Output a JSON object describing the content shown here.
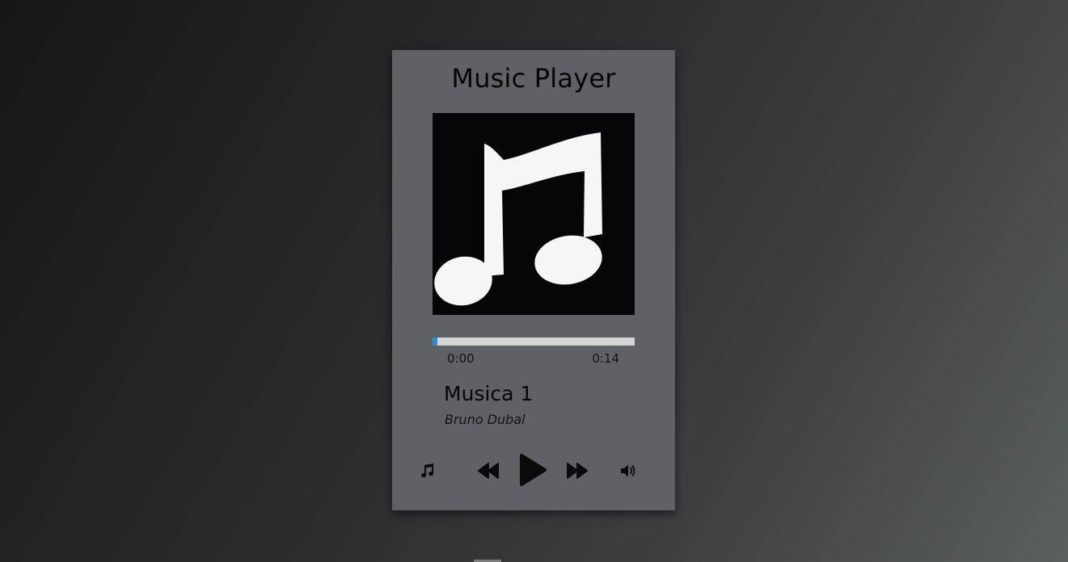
{
  "app": {
    "title": "Music Player"
  },
  "track": {
    "title": "Musica 1",
    "artist": "Bruno Dubal",
    "current_time": "0:00",
    "duration": "0:14",
    "progress_fraction": 0.025
  },
  "controls": {
    "playlist_icon": "music-note-icon",
    "previous_icon": "rewind-icon",
    "play_icon": "play-icon",
    "next_icon": "fast-forward-icon",
    "volume_icon": "volume-icon"
  },
  "colors": {
    "card_background": "#5f6166",
    "progress_fill": "#2e8fcf",
    "progress_track": "#d6d6d6",
    "cover_background": "#050607"
  }
}
